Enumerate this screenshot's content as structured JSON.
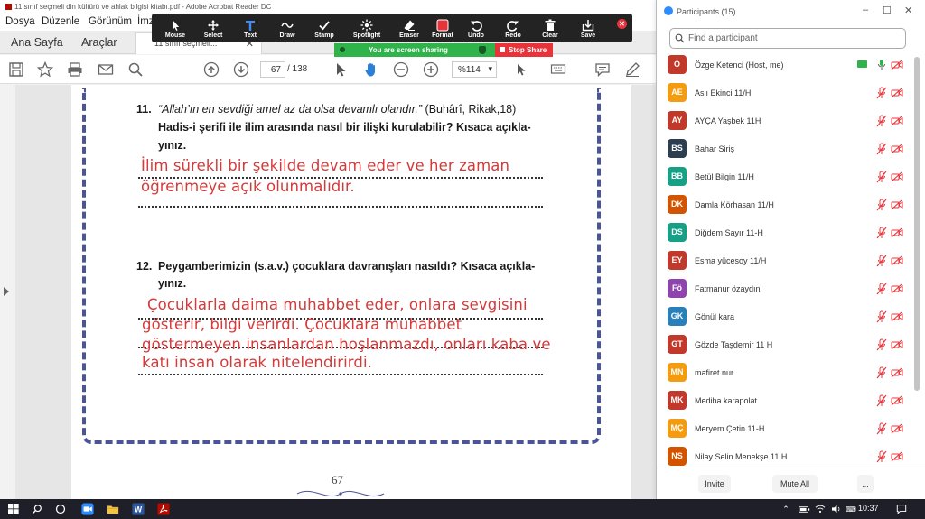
{
  "acrobat": {
    "title": "11 sınıf seçmeli din kültürü ve ahlak bilgisi kitabı.pdf - Adobe Acrobat Reader DC",
    "menu": [
      "Dosya",
      "Düzenle",
      "Görünüm",
      "İmza"
    ],
    "tabs": {
      "home": "Ana Sayfa",
      "tools": "Araçlar",
      "document": "11 sınıf seçmeli..."
    },
    "page_current": "67",
    "page_total": "/ 138",
    "zoom": "%114",
    "toolbar_icons": [
      "save-icon",
      "bookmark-star-icon",
      "print-icon",
      "mail-icon",
      "search-icon",
      "prev-page-icon",
      "next-page-icon",
      "zoom-out-icon",
      "zoom-in-icon",
      "select-arrow-icon",
      "hand-icon",
      "comment-icon",
      "pen-icon"
    ]
  },
  "document": {
    "q11": {
      "num": "11.",
      "line1_quote": "“Allah’ın en sevdiği amel az da olsa devamlı olandır.”",
      "line1_src": "(Buhârî, Rikak,18)",
      "line2": "Hadis-i şerifi ile ilim arasında nasıl bir ilişki kurulabilir? Kısaca açıkla-",
      "line3": "yınız."
    },
    "a11": [
      "İlim sürekli bir şekilde devam eder ve her zaman",
      "öğrenmeye açık olunmalıdır."
    ],
    "q12": {
      "num": "12.",
      "line1": "Peygamberimizin (s.a.v.) çocuklara davranışları nasıldı? Kısaca açıkla-",
      "line2": "yınız."
    },
    "a12": [
      "Çocuklarla daima muhabbet eder, onlara sevgisini",
      "gösterir, bilgi verirdi. Çocuklara muhabbet",
      "göstermeyen insanlardan hoşlanmazdı, onları kaba ve",
      "katı insan olarak nitelendirirdi."
    ],
    "page_number": "67"
  },
  "annotate_bar": {
    "tools": [
      "Mouse",
      "Select",
      "Text",
      "Draw",
      "Stamp",
      "Spotlight",
      "Eraser",
      "Format",
      "Undo",
      "Redo",
      "Clear",
      "Save"
    ],
    "active_tool": "Text"
  },
  "share": {
    "status": "You are screen sharing",
    "stop": "Stop Share"
  },
  "participants": {
    "title": "Participants (15)",
    "search_placeholder": "Find a participant",
    "list": [
      {
        "initials": "Ö",
        "name": "Özge Ketenci (Host, me)",
        "color": "#c0392b"
      },
      {
        "initials": "AE",
        "name": "Aslı Ekinci 11/H",
        "color": "#f39c12"
      },
      {
        "initials": "AY",
        "name": "AYÇA Yaşbek  11H",
        "color": "#c0392b"
      },
      {
        "initials": "BS",
        "name": "Bahar Siriş",
        "color": "#2c3e50"
      },
      {
        "initials": "BB",
        "name": "Betül Bilgin 11/H",
        "color": "#16a085"
      },
      {
        "initials": "DK",
        "name": "Damla Körhasan 11/H",
        "color": "#d35400"
      },
      {
        "initials": "DS",
        "name": "Diğdem Sayır 11-H",
        "color": "#16a085"
      },
      {
        "initials": "EY",
        "name": "Esma yücesoy 11/H",
        "color": "#c0392b"
      },
      {
        "initials": "Fö",
        "name": "Fatmanur özaydın",
        "color": "#8e44ad"
      },
      {
        "initials": "GK",
        "name": "Gönül kara",
        "color": "#2980b9"
      },
      {
        "initials": "GT",
        "name": "Gözde  Taşdemir 11 H",
        "color": "#c0392b"
      },
      {
        "initials": "MN",
        "name": "mafiret nur",
        "color": "#f39c12"
      },
      {
        "initials": "MK",
        "name": "Mediha karapolat",
        "color": "#c0392b"
      },
      {
        "initials": "MÇ",
        "name": "Meryem Çetin 11-H",
        "color": "#f39c12"
      },
      {
        "initials": "NS",
        "name": "Nilay Selin Menekşe 11 H",
        "color": "#d35400"
      }
    ],
    "invite": "Invite",
    "mute_all": "Mute All",
    "more": "..."
  },
  "taskbar": {
    "time": "10:37",
    "apps": [
      "windows-start-icon",
      "search-icon",
      "cortana-icon",
      "zoom-app-icon",
      "file-explorer-icon",
      "word-icon",
      "acrobat-icon"
    ]
  }
}
